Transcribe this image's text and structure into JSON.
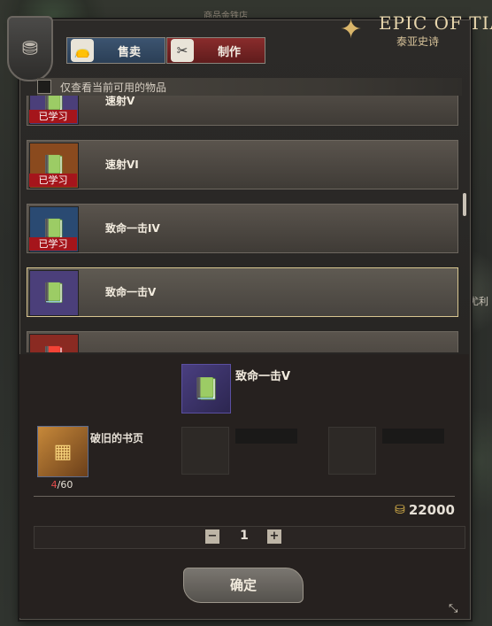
{
  "window": {
    "top_faint_label": "商品金铁店",
    "logo_brand": "EPIC OF TIA",
    "logo_subtitle": "泰亚史诗",
    "side_label": "尤利"
  },
  "tabs": [
    {
      "label": "售卖",
      "icon": "bag-icon"
    },
    {
      "label": "制作",
      "icon": "scissors-icon"
    }
  ],
  "filter": {
    "label": "仅查看当前可用的物品",
    "checked": false
  },
  "recipes": [
    {
      "name": "速射V",
      "learned": true,
      "learned_label": "已学习",
      "color": "#4b3f7a",
      "selected": false
    },
    {
      "name": "速射VI",
      "learned": true,
      "learned_label": "已学习",
      "color": "#8a4a1e",
      "selected": false
    },
    {
      "name": "致命一击IV",
      "learned": true,
      "learned_label": "已学习",
      "color": "#2a4a72",
      "selected": false
    },
    {
      "name": "致命一击V",
      "learned": false,
      "learned_label": "",
      "color": "#4b3f7a",
      "selected": true
    },
    {
      "name": "",
      "learned": false,
      "learned_label": "",
      "color": "#8a2a22",
      "selected": false
    }
  ],
  "detail": {
    "selected_name": "致命一击V",
    "material": {
      "name": "破旧的书页",
      "have": "4",
      "need": "/60"
    },
    "cost": "22000",
    "quantity": "1",
    "minus_label": "−",
    "plus_label": "+",
    "confirm_label": "确定"
  }
}
